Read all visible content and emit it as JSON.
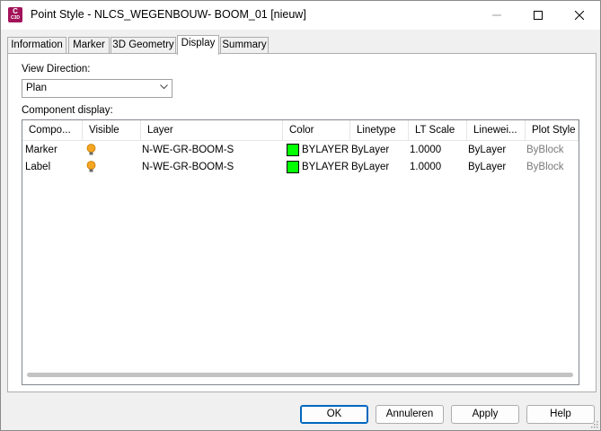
{
  "window": {
    "title": "Point Style - NLCS_WEGENBOUW- BOOM_01 [nieuw]",
    "app_icon_letter": "C",
    "app_icon_sub": "C3D"
  },
  "tabs": [
    {
      "label": "Information",
      "active": false
    },
    {
      "label": "Marker",
      "active": false
    },
    {
      "label": "3D Geometry",
      "active": false
    },
    {
      "label": "Display",
      "active": true
    },
    {
      "label": "Summary",
      "active": false
    }
  ],
  "view_direction": {
    "label": "View Direction:",
    "value": "Plan"
  },
  "component_display": {
    "label": "Component display:",
    "columns": [
      "Compo...",
      "Visible",
      "Layer",
      "Color",
      "Linetype",
      "LT Scale",
      "Linewei...",
      "Plot Style"
    ],
    "rows": [
      {
        "component": "Marker",
        "visible": true,
        "layer": "N-WE-GR-BOOM-S",
        "color_name": "BYLAYER",
        "color_hex": "#00ff00",
        "linetype": "ByLayer",
        "lt_scale": "1.0000",
        "lineweight": "ByLayer",
        "plot_style": "ByBlock"
      },
      {
        "component": "Label",
        "visible": true,
        "layer": "N-WE-GR-BOOM-S",
        "color_name": "BYLAYER",
        "color_hex": "#00ff00",
        "linetype": "ByLayer",
        "lt_scale": "1.0000",
        "lineweight": "ByLayer",
        "plot_style": "ByBlock"
      }
    ]
  },
  "buttons": {
    "ok": "OK",
    "cancel": "Annuleren",
    "apply": "Apply",
    "help": "Help"
  },
  "icons": {
    "visible": "lightbulb-on-icon",
    "dropdown": "chevron-down-icon"
  },
  "colors": {
    "bulb": "#f5a623",
    "default_button_border": "#0067c0"
  }
}
